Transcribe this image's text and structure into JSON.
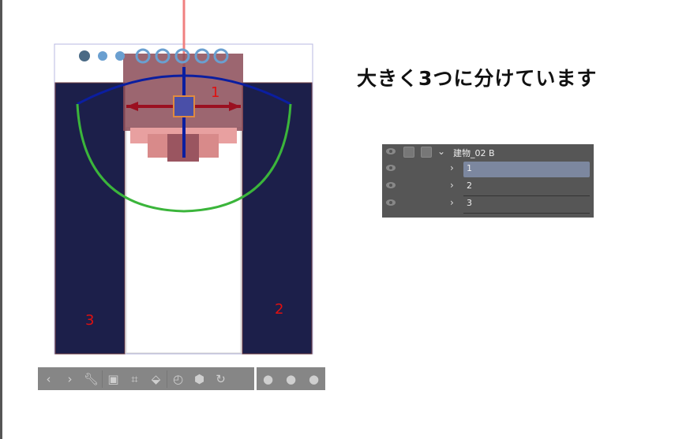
{
  "heading": "大きく3つに分けています",
  "canvas": {
    "labels": [
      "1",
      "2",
      "3"
    ],
    "colors": {
      "dark_blue": "#1c1f4a",
      "building": "#8b4b57",
      "blue_ring": "#0b1ea0",
      "green_ring": "#3bb53b",
      "red_axis": "#e05050"
    }
  },
  "layers": {
    "group": "建物_02  B",
    "items": [
      "1",
      "2",
      "3"
    ],
    "selected": "1"
  },
  "toolbar": {
    "icons": [
      "chevron-left",
      "chevron-right",
      "wrench",
      "camera",
      "focus",
      "floor",
      "rotate-reset",
      "object-reset",
      "orbit-reset",
      "light-1",
      "light-2",
      "light-3"
    ]
  }
}
